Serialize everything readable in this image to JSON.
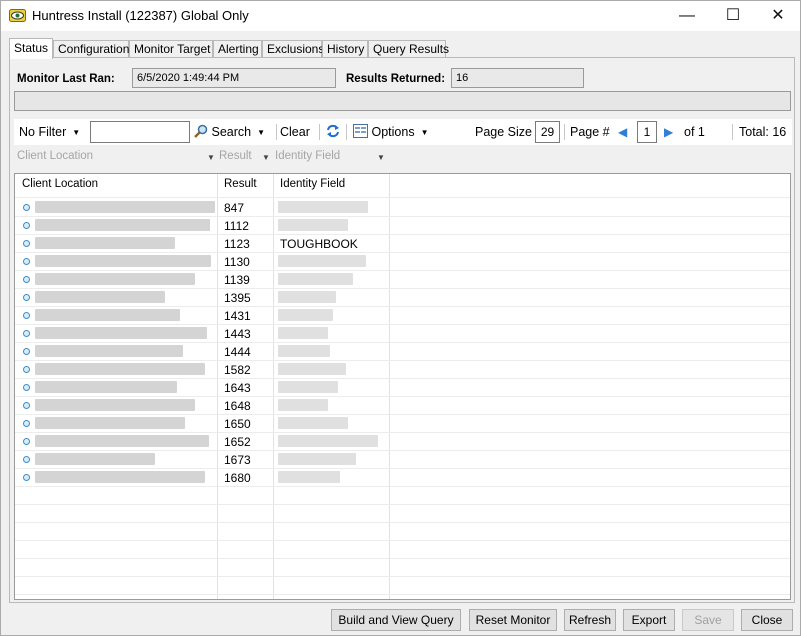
{
  "window": {
    "title": "Huntress Install (122387) Global Only",
    "minimize": "—",
    "maximize": "☐",
    "close": "✕"
  },
  "tabs": [
    {
      "label": "Status",
      "active": true
    },
    {
      "label": "Configuration"
    },
    {
      "label": "Monitor Target"
    },
    {
      "label": "Alerting"
    },
    {
      "label": "Exclusions"
    },
    {
      "label": "History"
    },
    {
      "label": "Query Results"
    }
  ],
  "status": {
    "last_ran_label": "Monitor Last Ran:",
    "last_ran_value": "6/5/2020 1:49:44 PM",
    "results_label": "Results Returned:",
    "results_value": "16"
  },
  "toolbar": {
    "filter_dropdown": "No Filter",
    "filter_input_value": "",
    "search_label": "Search",
    "clear_label": "Clear",
    "options_label": "Options",
    "page_size_label": "Page Size",
    "page_size_value": "29",
    "page_label": "Page #",
    "page_value": "1",
    "of_label": "of 1",
    "total_label": "Total: 16"
  },
  "filters": {
    "client_location": "Client Location",
    "result": "Result",
    "identity_field": "Identity Field"
  },
  "grid": {
    "columns": [
      "Client Location",
      "Result",
      "Identity Field"
    ],
    "rows": [
      {
        "result": "847",
        "identity": ""
      },
      {
        "result": "1112",
        "identity": ""
      },
      {
        "result": "1123",
        "identity": "TOUGHBOOK"
      },
      {
        "result": "1130",
        "identity": ""
      },
      {
        "result": "1139",
        "identity": ""
      },
      {
        "result": "1395",
        "identity": ""
      },
      {
        "result": "1431",
        "identity": ""
      },
      {
        "result": "1443",
        "identity": ""
      },
      {
        "result": "1444",
        "identity": ""
      },
      {
        "result": "1582",
        "identity": ""
      },
      {
        "result": "1643",
        "identity": ""
      },
      {
        "result": "1648",
        "identity": ""
      },
      {
        "result": "1650",
        "identity": ""
      },
      {
        "result": "1652",
        "identity": ""
      },
      {
        "result": "1673",
        "identity": ""
      },
      {
        "result": "1680",
        "identity": ""
      }
    ]
  },
  "buttons": {
    "build_query": "Build and View Query",
    "reset_monitor": "Reset Monitor",
    "refresh": "Refresh",
    "export": "Export",
    "save": "Save",
    "close": "Close"
  },
  "icons": {
    "app": "monitor-eye-icon",
    "search": "magnifier-icon",
    "refresh": "refresh-arrows-icon",
    "options": "options-grid-icon"
  }
}
